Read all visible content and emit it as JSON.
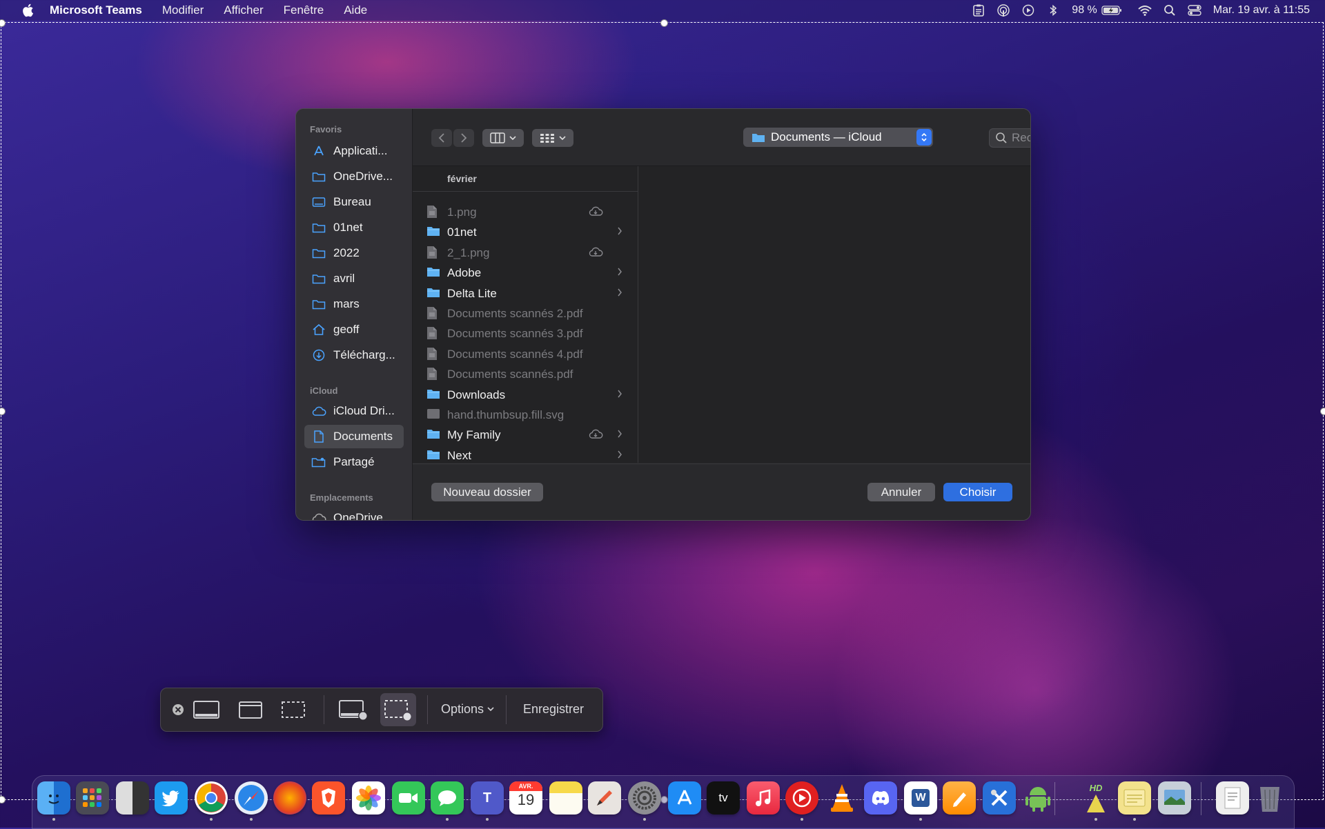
{
  "menubar": {
    "app_name": "Microsoft Teams",
    "menus": [
      "Modifier",
      "Afficher",
      "Fenêtre",
      "Aide"
    ],
    "battery": "98 %",
    "clock": "Mar. 19 avr. à  11:55"
  },
  "dialog": {
    "sidebar": {
      "favorites_header": "Favoris",
      "favorites": [
        "Applicati...",
        "OneDrive...",
        "Bureau",
        "01net",
        "2022",
        "avril",
        "mars",
        "geoff",
        "Télécharg..."
      ],
      "icloud_header": "iCloud",
      "icloud": [
        "iCloud Dri...",
        "Documents",
        "Partagé"
      ],
      "locations_header": "Emplacements",
      "locations": [
        "OneDrive"
      ]
    },
    "location": "Documents — iCloud",
    "search_placeholder": "Rechercher",
    "column_header": "février",
    "files": [
      {
        "name": "1.png",
        "kind": "file",
        "dim": true,
        "cloud": true,
        "folder": false
      },
      {
        "name": "01net",
        "kind": "folder",
        "dim": false,
        "cloud": false,
        "folder": true
      },
      {
        "name": "2_1.png",
        "kind": "file",
        "dim": true,
        "cloud": true,
        "folder": false
      },
      {
        "name": "Adobe",
        "kind": "folder",
        "dim": false,
        "cloud": false,
        "folder": true
      },
      {
        "name": "Delta Lite",
        "kind": "folder",
        "dim": false,
        "cloud": false,
        "folder": true
      },
      {
        "name": "Documents scannés 2.pdf",
        "kind": "file",
        "dim": true,
        "cloud": false,
        "folder": false
      },
      {
        "name": "Documents scannés 3.pdf",
        "kind": "file",
        "dim": true,
        "cloud": false,
        "folder": false
      },
      {
        "name": "Documents scannés 4.pdf",
        "kind": "file",
        "dim": true,
        "cloud": false,
        "folder": false
      },
      {
        "name": "Documents scannés.pdf",
        "kind": "file",
        "dim": true,
        "cloud": false,
        "folder": false
      },
      {
        "name": "Downloads",
        "kind": "folder",
        "dim": false,
        "cloud": false,
        "folder": true
      },
      {
        "name": "hand.thumbsup.fill.svg",
        "kind": "image",
        "dim": true,
        "cloud": false,
        "folder": false
      },
      {
        "name": "My Family",
        "kind": "folder",
        "dim": false,
        "cloud": true,
        "folder": true
      },
      {
        "name": "Next",
        "kind": "folder",
        "dim": false,
        "cloud": false,
        "folder": true
      }
    ],
    "new_folder_label": "Nouveau dossier",
    "cancel_label": "Annuler",
    "choose_label": "Choisir"
  },
  "capture_toolbar": {
    "options_label": "Options",
    "record_label": "Enregistrer"
  },
  "dock": {
    "calendar_month": "AVR.",
    "calendar_day": "19",
    "tv_label": "tv",
    "word_label": "W",
    "teams_label": "T",
    "hd_label": "HD"
  },
  "colors": {
    "accent": "#2e6fe0",
    "folder": "#5fb2f2",
    "dialog_bg": "#262629",
    "sidebar_bg": "#313035"
  }
}
